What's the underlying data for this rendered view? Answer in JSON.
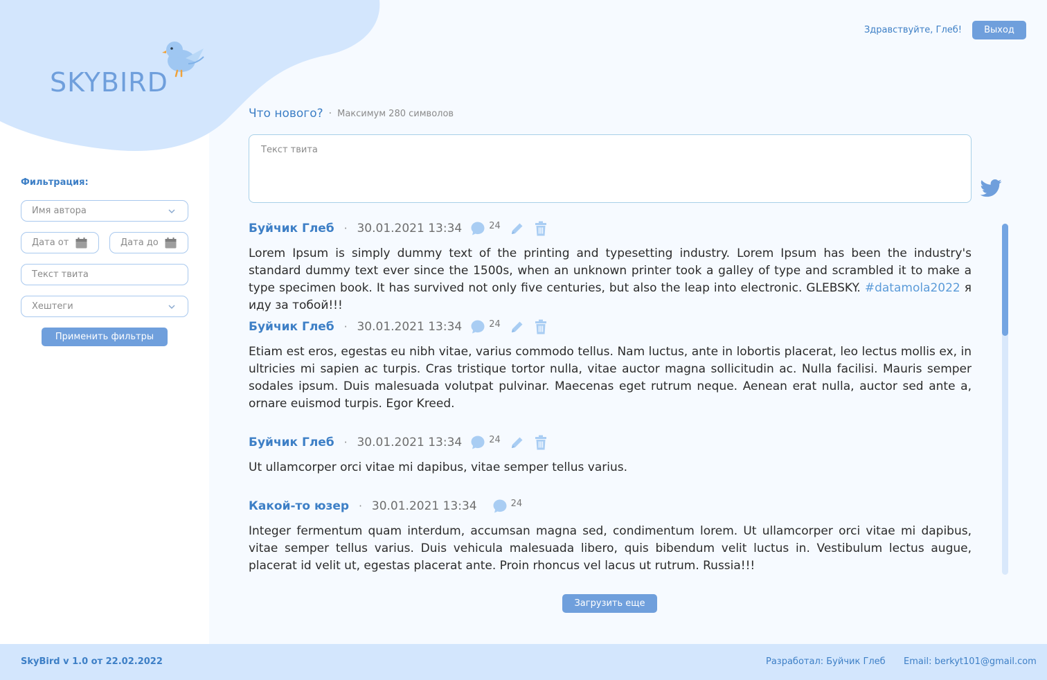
{
  "app": {
    "logo_text": "SKYBIRD",
    "brand_color": "#6f9fdc",
    "accent_color": "#3d7fc6"
  },
  "header": {
    "greeting": "Здравствуйте, Глеб!",
    "logout_label": "Выход"
  },
  "filters": {
    "title": "Фильтрация:",
    "author_placeholder": "Имя автора",
    "date_from_placeholder": "Дата от",
    "date_to_placeholder": "Дата до",
    "text_placeholder": "Текст твита",
    "hashtags_placeholder": "Хештеги",
    "apply_label": "Применить фильтры"
  },
  "compose": {
    "title": "Что нового?",
    "hint": "Максимум 280 символов",
    "placeholder": "Текст твита",
    "send_icon": "twitter-bird-icon"
  },
  "tweets": [
    {
      "author": "Буйчик Глеб",
      "date": "30.01.2021 13:34",
      "comments": "24",
      "editable": true,
      "text_before": "Lorem Ipsum is simply dummy text of the printing and typesetting industry. Lorem Ipsum has been the industry's standard dummy text ever since the 1500s, when an unknown printer took a galley of type and scrambled it to make a type specimen book. It has survived not only five centuries, but also the leap into electronic. GLEBSKY. ",
      "hashtag": "#datamola2022",
      "text_after": " я иду за тобой!!!"
    },
    {
      "author": "Буйчик Глеб",
      "date": "30.01.2021 13:34",
      "comments": "24",
      "editable": true,
      "text": "Etiam est eros, egestas eu nibh vitae, varius commodo tellus. Nam luctus, ante in lobortis placerat, leo lectus mollis ex, in ultricies mi sapien ac turpis. Cras tristique tortor nulla, vitae auctor magna sollicitudin ac. Nulla facilisi. Mauris semper sodales ipsum. Duis malesuada volutpat pulvinar. Maecenas eget rutrum neque. Aenean erat nulla, auctor sed ante a, ornare euismod turpis. Egor Kreed."
    },
    {
      "author": "Буйчик Глеб",
      "date": "30.01.2021 13:34",
      "comments": "24",
      "editable": true,
      "text": "Ut ullamcorper orci vitae mi dapibus, vitae semper tellus varius."
    },
    {
      "author": "Какой-то юзер",
      "date": "30.01.2021 13:34",
      "comments": "24",
      "editable": false,
      "text": "Integer fermentum quam interdum, accumsan magna sed, condimentum lorem. Ut ullamcorper orci vitae mi dapibus, vitae semper tellus varius. Duis vehicula malesuada libero, quis bibendum velit luctus in. Vestibulum lectus augue, placerat id velit ut, egestas placerat ante. Proin rhoncus vel lacus ut rutrum. Russia!!!"
    }
  ],
  "load_more_label": "Загрузить еще",
  "footer": {
    "version": "SkyBird v 1.0 от 22.02.2022",
    "developer": "Разработал: Буйчик Глеб",
    "email": "Email: berkyt101@gmail.com"
  }
}
